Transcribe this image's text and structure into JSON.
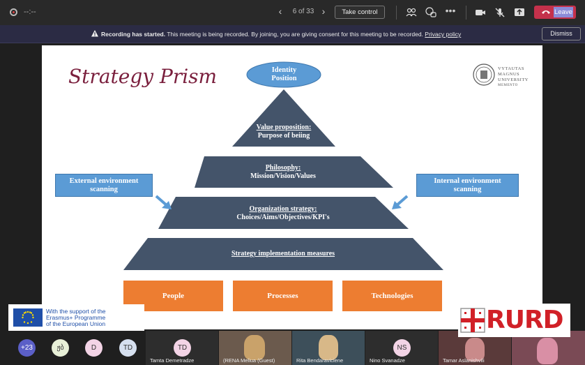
{
  "toolbar": {
    "timer": "--:--",
    "page_indicator": "6 of 33",
    "take_control_label": "Take control",
    "leave_label": "Leave"
  },
  "banner": {
    "bold": "Recording has started.",
    "message": "This meeting is being recorded. By joining, you are giving consent for this meeting to be recorded.",
    "link": "Privacy policy",
    "dismiss_label": "Dismiss"
  },
  "slide": {
    "title": "Strategy Prism",
    "university": [
      "VYTAUTAS",
      "MAGNUS",
      "UNIVERSITY",
      "MEMENTO"
    ],
    "top_ellipse": [
      "Identity",
      "Position"
    ],
    "tier1": {
      "title": "Value proposition:",
      "subtitle": "Purpose of beiing"
    },
    "tier2": {
      "title": "Philosophy:",
      "subtitle": "Mission/Vision/Values"
    },
    "tier3": {
      "title": "Organization strategy:",
      "subtitle": "Choices/Aims/Objectives/KPI's"
    },
    "tier4": {
      "title": "Strategy implementation measures"
    },
    "left_box": [
      "External environment",
      "scanning"
    ],
    "right_box": [
      "Internal environment",
      "scanning"
    ],
    "pillars": [
      "People",
      "Processes",
      "Technologies"
    ]
  },
  "erasmus": {
    "lines": [
      "With the support of the",
      "Erasmus+ Programme",
      "of the European Union"
    ]
  },
  "rurd_logo": "RURD",
  "participants": {
    "overflow": "+23",
    "avatars": [
      {
        "initials": "ჟბ",
        "color": "#e8f0d8"
      },
      {
        "initials": "D",
        "color": "#f3d4e6"
      },
      {
        "initials": "TD",
        "color": "#d6e0ef"
      }
    ],
    "tiles": [
      {
        "initials": "TD",
        "name": "Tamta Demetradze"
      },
      {
        "initials": "",
        "name": "(RENA Meliua (Guest)"
      },
      {
        "initials": "",
        "name": "Rita Bendaraviciene"
      },
      {
        "initials": "NS",
        "name": "Nino Svanadze"
      },
      {
        "initials": "",
        "name": "Tamar Aslanishvili"
      },
      {
        "initials": "",
        "name": ""
      }
    ]
  },
  "colors": {
    "pyramid": "#44546a",
    "accent_blue": "#5b9bd5",
    "orange": "#ed7d31",
    "title": "#7a1f3d",
    "leave": "#c4314b"
  }
}
